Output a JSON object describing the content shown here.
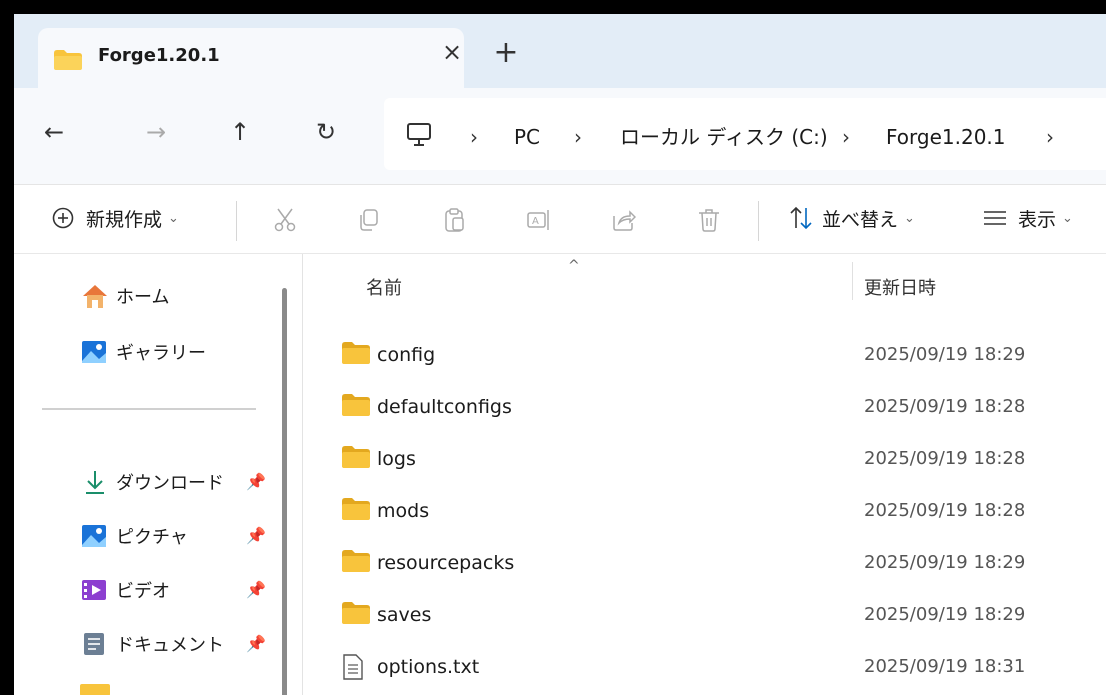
{
  "tab": {
    "title": "Forge1.20.1",
    "close": "×",
    "new_tab": "+"
  },
  "nav": {
    "back": "←",
    "forward": "→",
    "up": "↑",
    "refresh": "↻"
  },
  "address": {
    "crumbs": [
      "PC",
      "ローカル ディスク (C:)",
      "Forge1.20.1"
    ],
    "separator": "›"
  },
  "commands": {
    "new_label": "新規作成",
    "sort_label": "並べ替え",
    "view_label": "表示"
  },
  "sidebar": {
    "items": [
      {
        "label": "ホーム",
        "icon": "home-icon"
      },
      {
        "label": "ギャラリー",
        "icon": "gallery-icon"
      },
      {
        "label": "ダウンロード",
        "icon": "download-icon",
        "pinned": true
      },
      {
        "label": "ピクチャ",
        "icon": "pictures-icon",
        "pinned": true
      },
      {
        "label": "ビデオ",
        "icon": "videos-icon",
        "pinned": true
      },
      {
        "label": "ドキュメント",
        "icon": "documents-icon",
        "pinned": true
      }
    ]
  },
  "columns": {
    "name": "名前",
    "modified": "更新日時"
  },
  "files": [
    {
      "name": "config",
      "date": "2025/09/19 18:29",
      "type": "folder"
    },
    {
      "name": "defaultconfigs",
      "date": "2025/09/19 18:28",
      "type": "folder"
    },
    {
      "name": "logs",
      "date": "2025/09/19 18:28",
      "type": "folder"
    },
    {
      "name": "mods",
      "date": "2025/09/19 18:28",
      "type": "folder"
    },
    {
      "name": "resourcepacks",
      "date": "2025/09/19 18:29",
      "type": "folder"
    },
    {
      "name": "saves",
      "date": "2025/09/19 18:29",
      "type": "folder"
    },
    {
      "name": "options.txt",
      "date": "2025/09/19 18:31",
      "type": "text-file"
    }
  ],
  "colors": {
    "folder": "#f8c43c",
    "folder_dark": "#e3a81f",
    "accent": "#0067c0"
  }
}
